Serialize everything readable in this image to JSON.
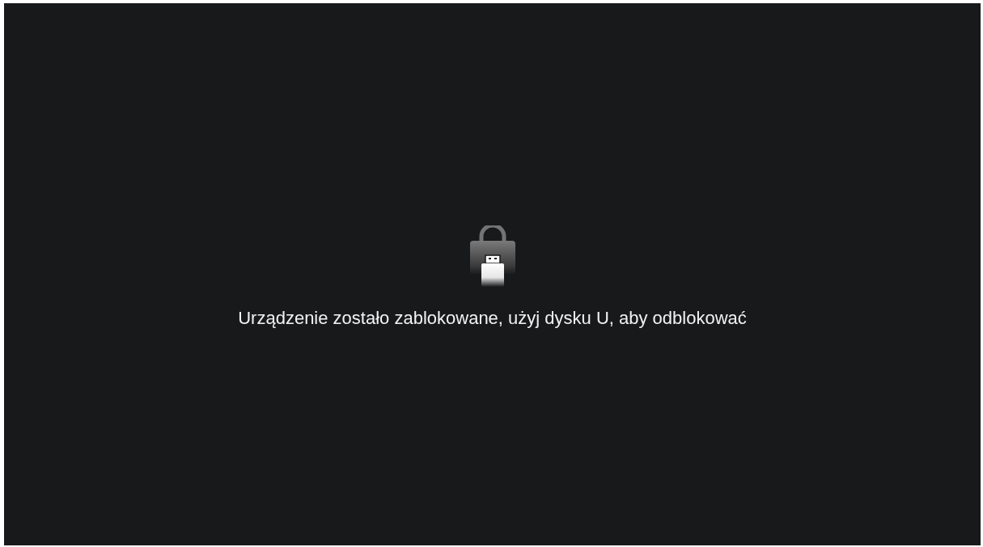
{
  "message": "Urządzenie zostało zablokowane, użyj dysku U, aby odblokować"
}
